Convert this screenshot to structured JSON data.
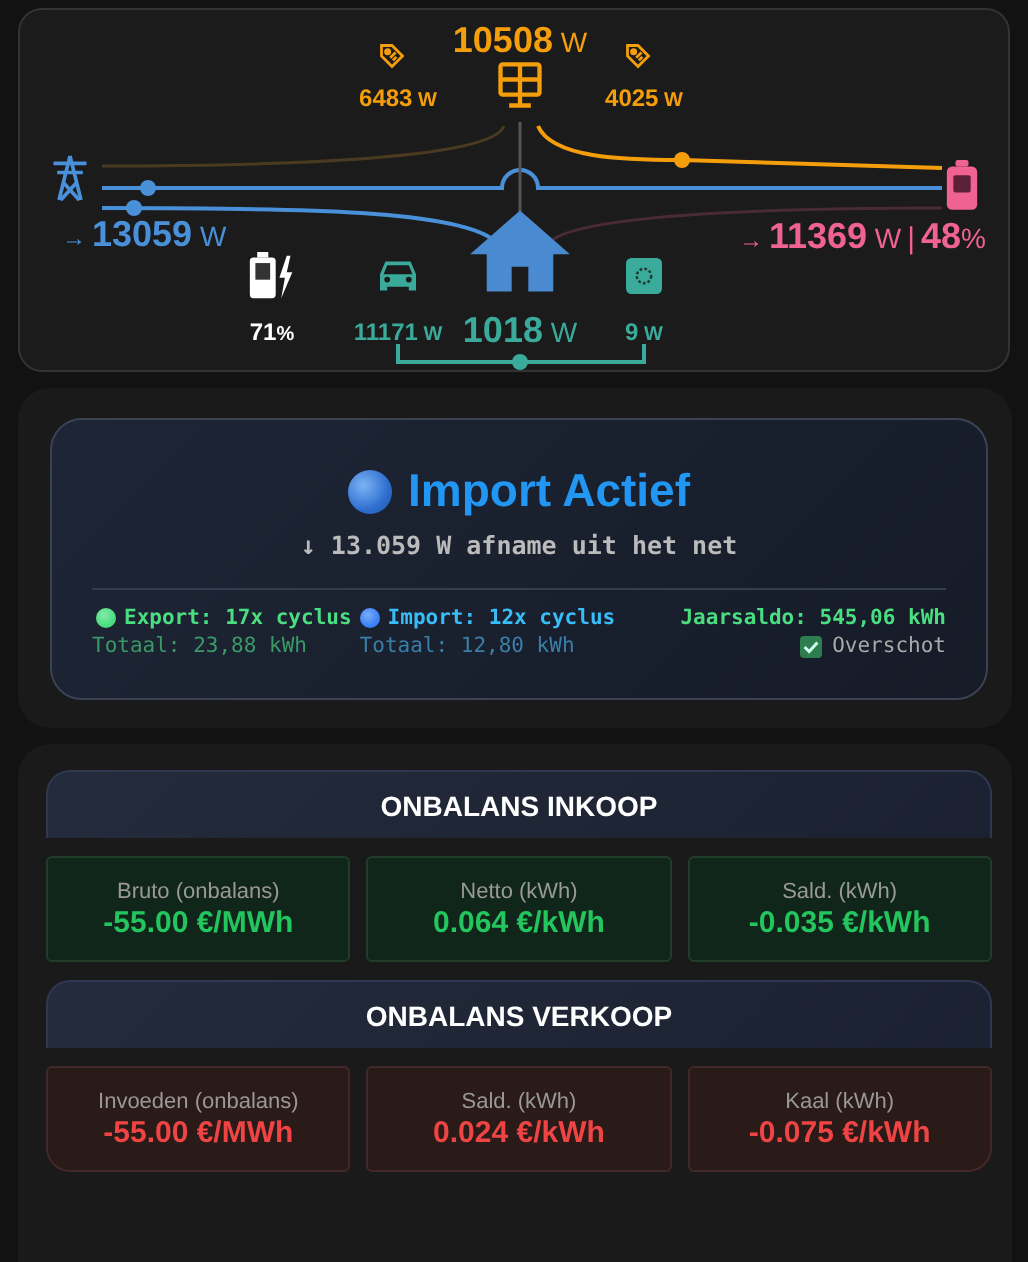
{
  "flow": {
    "solar": {
      "value": "10508",
      "unit": "W"
    },
    "solar_split": [
      {
        "value": "6483",
        "unit": "W"
      },
      {
        "value": "4025",
        "unit": "W"
      }
    ],
    "grid": {
      "arrow": "→",
      "value": "13059",
      "unit": "W"
    },
    "battery": {
      "arrow": "→",
      "value": "11369",
      "unit": "W",
      "separator": "|",
      "percent": "48",
      "percent_unit": "%"
    },
    "home": {
      "value": "1018",
      "unit": "W"
    },
    "devices": [
      {
        "kind": "ev-battery",
        "value": "71",
        "unit": "%"
      },
      {
        "kind": "car",
        "value": "11171",
        "unit": "W"
      },
      {
        "kind": "appliance",
        "value": "9",
        "unit": "W"
      }
    ]
  },
  "status": {
    "title": "Import Actief",
    "subtitle": "↓ 13.059 W afname uit het net",
    "stats": [
      {
        "label": "Export: 17x cyclus",
        "total": "Totaal: 23,88 kWh",
        "color": "#4ade80"
      },
      {
        "label": "Import: 12x cyclus",
        "total": "Totaal: 12,80 kWh",
        "color": "#3b82f6"
      }
    ],
    "year_balance": "Jaarsaldo: 545,06 kWh",
    "surplus": {
      "label": "Overschot",
      "checked": true
    }
  },
  "tariffs": [
    {
      "title": "ONBALANS INKOOP",
      "kind": "buy",
      "cells": [
        {
          "label": "Bruto (onbalans)",
          "value": "-55.00 €/MWh"
        },
        {
          "label": "Netto (kWh)",
          "value": "0.064 €/kWh"
        },
        {
          "label": "Sald. (kWh)",
          "value": "-0.035 €/kWh"
        }
      ]
    },
    {
      "title": "ONBALANS VERKOOP",
      "kind": "sell",
      "cells": [
        {
          "label": "Invoeden (onbalans)",
          "value": "-55.00 €/MWh"
        },
        {
          "label": "Sald. (kWh)",
          "value": "0.024 €/kWh"
        },
        {
          "label": "Kaal (kWh)",
          "value": "-0.075 €/kWh"
        }
      ]
    }
  ]
}
